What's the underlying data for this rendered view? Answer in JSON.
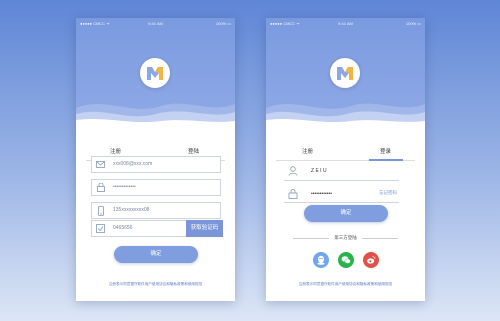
{
  "status_bar": {
    "carrier": "●●●●● CMCC ᯤ",
    "time": "9:41 AM",
    "battery": "100% ▭"
  },
  "left_screen": {
    "tabs": {
      "register": "注册",
      "login": "登陆"
    },
    "email_value": "xxx008@xxx.com",
    "password_value": "•••••••••••••",
    "phone_value": "135xxxxxxxxx08",
    "code_value": "0465656",
    "sms_button": "获取验证码",
    "submit_button": "确定",
    "agreement": "注册表示同意遵守软件用户使用协议和隐私政策和使用规范"
  },
  "right_screen": {
    "tabs": {
      "register": "注册",
      "login": "登录"
    },
    "username_value": "Z E I U",
    "password_value": "••••••••••••",
    "forgot_link": "忘记密码",
    "submit_button": "确定",
    "third_party_label": "第三方登陆",
    "agreement": "注册表示同意遵守软件用户使用协议和隐私政策和使用规范"
  },
  "colors": {
    "accent": "#7b96d8",
    "qq": "#6fa6ef",
    "wechat": "#2ab34a",
    "weibo": "#e2504a"
  },
  "icons": [
    "envelope-icon",
    "lock-icon",
    "phone-icon",
    "sms-code-icon",
    "user-icon",
    "qq-icon",
    "wechat-icon",
    "weibo-icon",
    "logo-m-icon"
  ]
}
